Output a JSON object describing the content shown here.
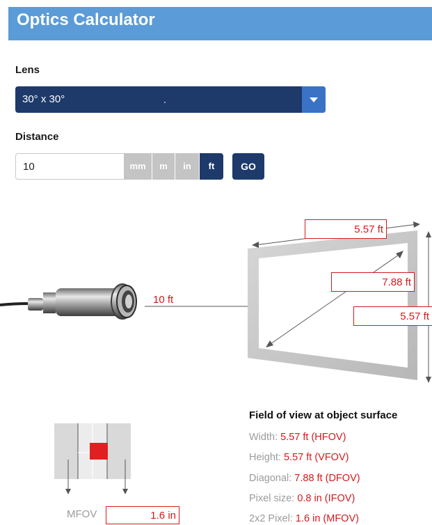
{
  "header": {
    "title": "Optics Calculator"
  },
  "lens": {
    "label": "Lens",
    "selected": "30° x 30°"
  },
  "distance": {
    "label": "Distance",
    "value": "10",
    "units": [
      "mm",
      "m",
      "in",
      "ft"
    ],
    "active_unit": "ft",
    "go_label": "GO"
  },
  "diagram": {
    "distance_label": "10 ft",
    "hfov_value": "5.57 ft",
    "dfov_value": "7.88 ft",
    "vfov_value": "5.57 ft"
  },
  "fov": {
    "title": "Field of view at object surface",
    "width_label": "Width: ",
    "width_value": "5.57 ft (HFOV)",
    "height_label": "Height: ",
    "height_value": "5.57 ft (VFOV)",
    "diagonal_label": "Diagonal: ",
    "diagonal_value": "7.88 ft (DFOV)",
    "pixel_label": "Pixel size: ",
    "pixel_value": "0.8 in (IFOV)",
    "pixel2_label": "2x2 Pixel: ",
    "pixel2_value": "1.6 in (MFOV)"
  },
  "mfov": {
    "label": "MFOV",
    "value": "1.6 in"
  },
  "colors": {
    "header": "#5b9bd8",
    "navy": "#1d3a6b",
    "accent_blue": "#3a73c6",
    "value_red": "#d7191c",
    "unit_grey": "#c4c4c4"
  }
}
